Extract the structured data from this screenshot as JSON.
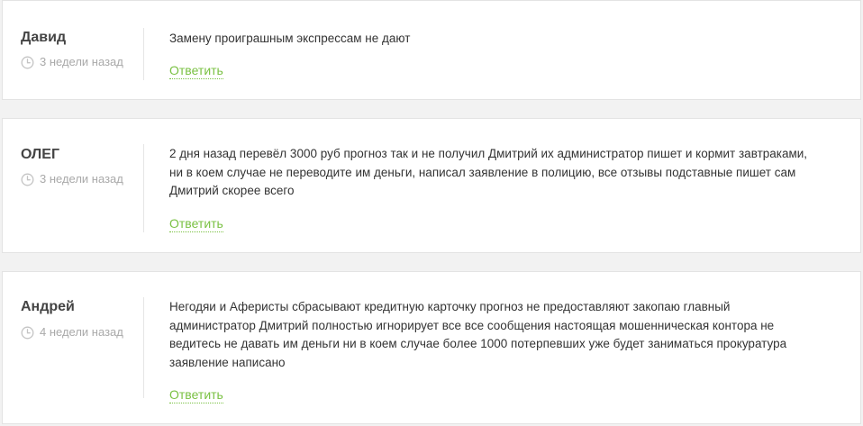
{
  "colors": {
    "background": "#f2f2f2",
    "card": "#ffffff",
    "accent": "#7ac143",
    "muted": "#a9a9a9",
    "text": "#333333"
  },
  "comments": [
    {
      "author": "Давид",
      "time_icon": "clock-icon",
      "time": "3 недели назад",
      "text": "Замену проиграшным экспрессам не дают",
      "reply_label": "Ответить"
    },
    {
      "author": "ОЛЕГ",
      "time_icon": "clock-icon",
      "time": "3 недели назад",
      "text": "2 дня назад перевёл 3000 руб прогноз так и не получил Дмитрий их администратор пишет и кормит завтраками,\nни в коем случае не переводите им деньги, написал заявление в полицию, все отзывы подставные пишет сам\nДмитрий скорее всего",
      "reply_label": "Ответить"
    },
    {
      "author": "Андрей",
      "time_icon": "clock-icon",
      "time": "4 недели назад",
      "text": "Негодяи и Аферисты сбрасывают кредитную карточку прогноз не предоставляют закопаю главный\nадминистратор Дмитрий полностью игнорирует все все сообщения настоящая мошенническая контора не\nведитесь не давать им деньги ни в коем случае более 1000 потерпевших уже будет заниматься прокуратура\nзаявление написано",
      "reply_label": "Ответить"
    }
  ]
}
